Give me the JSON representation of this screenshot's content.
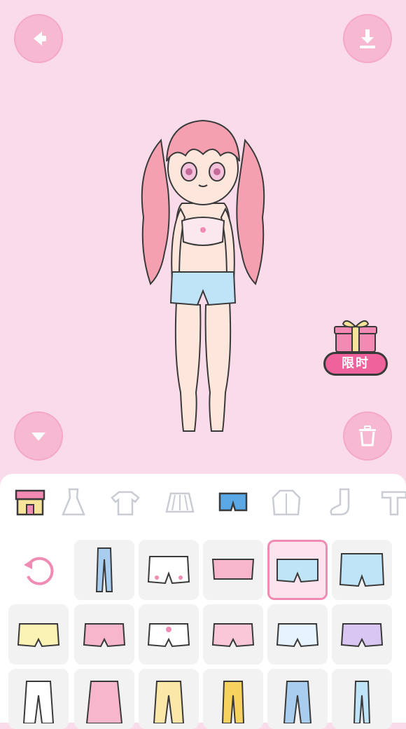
{
  "toolbar": {
    "back_icon": "arrow-left-icon",
    "download_icon": "download-icon",
    "collapse_icon": "chevron-down-icon",
    "trash_icon": "trash-icon"
  },
  "promo": {
    "label": "限时",
    "icon": "gift-icon"
  },
  "colors": {
    "background": "#f9dbea",
    "accent": "#f0629b",
    "button": "#f7b8d1",
    "selected_border": "#f08cb4"
  },
  "categories": [
    {
      "name": "shop",
      "icon": "shop-icon",
      "active": false
    },
    {
      "name": "dress",
      "icon": "dress-icon",
      "active": false
    },
    {
      "name": "top",
      "icon": "shirt-icon",
      "active": false
    },
    {
      "name": "skirt",
      "icon": "skirt-icon",
      "active": false
    },
    {
      "name": "bottoms",
      "icon": "shorts-icon",
      "active": true
    },
    {
      "name": "jacket",
      "icon": "jacket-icon",
      "active": false
    },
    {
      "name": "socks",
      "icon": "sock-icon",
      "active": false
    },
    {
      "name": "more",
      "icon": "tshirt-icon",
      "active": false
    }
  ],
  "items": [
    {
      "name": "reset",
      "icon": "reset-icon"
    },
    {
      "name": "blue-jeans",
      "icon": "jeans-icon"
    },
    {
      "name": "white-shorts-hearts",
      "icon": "shorts-icon"
    },
    {
      "name": "pink-mini-skirt",
      "icon": "skirt-icon"
    },
    {
      "name": "blue-denim-shorts",
      "icon": "shorts-icon",
      "selected": true
    },
    {
      "name": "light-blue-shorts",
      "icon": "shorts-icon"
    },
    {
      "name": "yellow-bloomers",
      "icon": "bloomers-icon"
    },
    {
      "name": "pink-shorts",
      "icon": "shorts-icon"
    },
    {
      "name": "white-bloomers-heart",
      "icon": "bloomers-icon"
    },
    {
      "name": "pink-floral-bloomers",
      "icon": "bloomers-icon"
    },
    {
      "name": "striped-bloomers",
      "icon": "bloomers-icon"
    },
    {
      "name": "lavender-bow-shorts",
      "icon": "shorts-icon"
    },
    {
      "name": "white-pants",
      "icon": "pants-icon"
    },
    {
      "name": "pink-lace-up-skirt",
      "icon": "skirt-icon"
    },
    {
      "name": "yellow-heart-pants",
      "icon": "pants-icon"
    },
    {
      "name": "yellow-pants",
      "icon": "pants-icon"
    },
    {
      "name": "blue-pajama-pants",
      "icon": "pants-icon"
    },
    {
      "name": "light-blue-jeans",
      "icon": "jeans-icon"
    }
  ]
}
